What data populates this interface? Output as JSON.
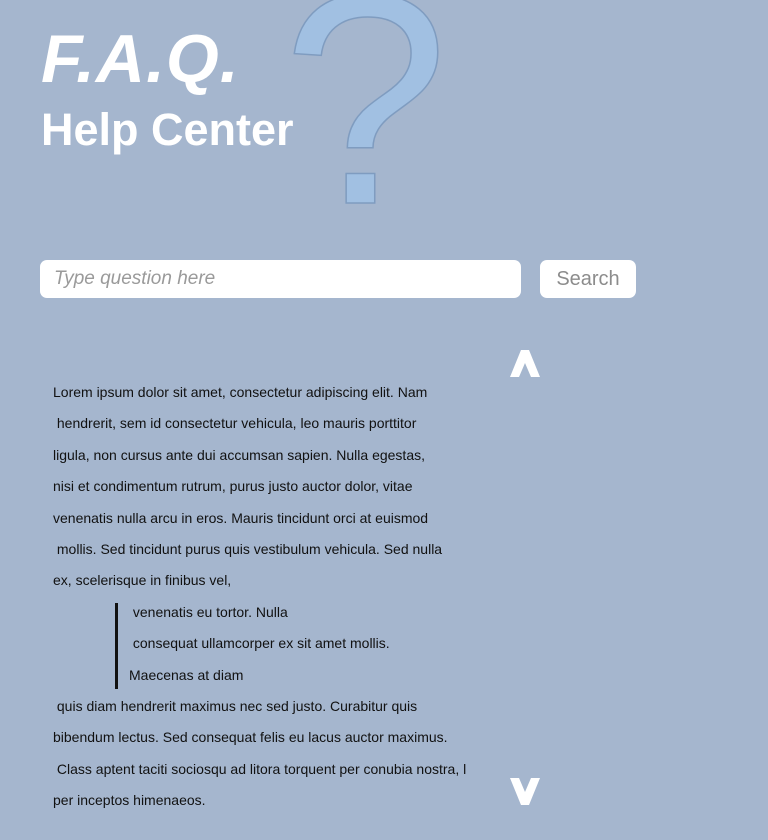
{
  "header": {
    "title": "F.A.Q.",
    "subtitle": "Help Center",
    "decor_glyph": "?"
  },
  "search": {
    "placeholder": "Type question here",
    "button_label": "Search"
  },
  "nav": {
    "up_icon": "chevron-up-icon",
    "down_icon": "chevron-down-icon"
  },
  "content": {
    "lines_before": [
      "Lorem ipsum dolor sit amet, consectetur adipiscing elit. Nam",
      " hendrerit, sem id consectetur vehicula, leo mauris porttitor",
      "ligula, non cursus ante dui accumsan sapien. Nulla egestas,",
      "nisi et condimentum rutrum, purus justo auctor dolor, vitae",
      "venenatis nulla arcu in eros. Mauris tincidunt orci at euismod",
      " mollis. Sed tincidunt purus quis vestibulum vehicula. Sed nulla",
      "ex, scelerisque in finibus vel,"
    ],
    "quote_lines": [
      " venenatis eu tortor. Nulla",
      " consequat ullamcorper ex sit amet mollis.",
      "Maecenas at diam"
    ],
    "lines_after": [
      " quis diam hendrerit maximus nec sed justo. Curabitur quis",
      "bibendum lectus. Sed consequat felis eu lacus auctor maximus.",
      " Class aptent taciti sociosqu ad litora torquent per conubia nostra, l",
      "per inceptos himenaeos."
    ]
  },
  "colors": {
    "background": "#a5b6ce",
    "question_mark": "#a1c0e2",
    "header_text": "#ffffff",
    "body_text": "#111111",
    "button_text": "#8c8c8c"
  }
}
